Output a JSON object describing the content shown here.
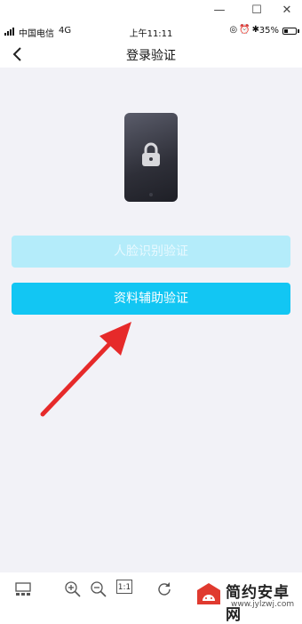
{
  "window": {
    "minimize_label": "—",
    "maximize_label": "☐",
    "close_label": "✕"
  },
  "status_bar": {
    "carrier": "中国电信",
    "network": "4G",
    "time": "上午11:11",
    "battery_percent": "35%",
    "battery_level": 0.35,
    "icons": [
      "target-icon",
      "alarm-icon",
      "bluetooth-icon"
    ]
  },
  "navbar": {
    "title": "登录验证"
  },
  "main": {
    "face_verify_label": "人脸识别验证",
    "data_verify_label": "资料辅助验证"
  },
  "colors": {
    "primary": "#12c6f3",
    "primary_disabled": "#b4ecfa",
    "arrow": "#e62a2a",
    "background": "#f2f2f7"
  },
  "toolbar": {
    "actual_size_label": "1:1"
  },
  "watermark": {
    "name": "简约安卓网",
    "url": "www.jylzwj.com"
  }
}
